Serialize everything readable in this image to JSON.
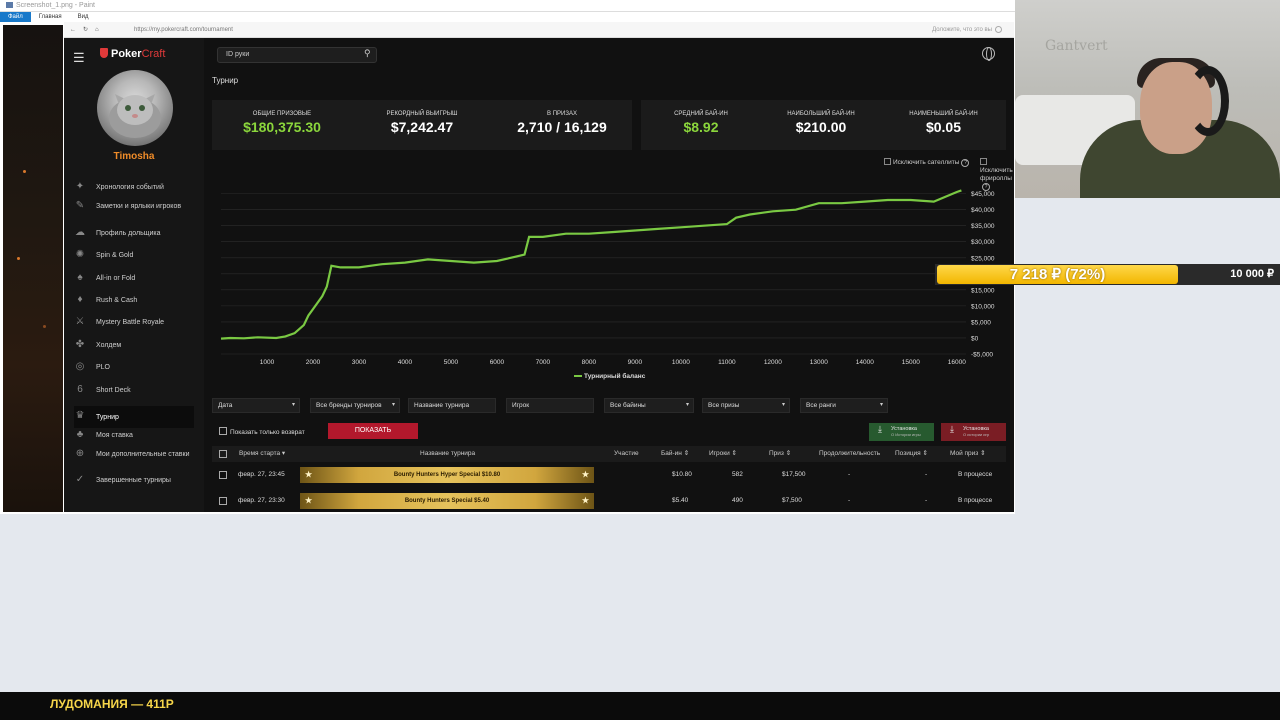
{
  "paint": {
    "title": "Screenshot_1.png - Paint",
    "menu": [
      "Файл",
      "Главная",
      "Вид"
    ]
  },
  "browser": {
    "url": "https://my.pokercraft.com/tournament",
    "hint": "Доложите, что это вы"
  },
  "sidebar": {
    "logo_left": "Poker",
    "logo_right": "Craft",
    "username": "Timosha",
    "items": [
      {
        "label": "Хронология событий",
        "icon": "timeline-icon"
      },
      {
        "label": "Заметки и ярлыки игроков",
        "icon": "notes-icon"
      },
      {
        "label": "Профиль дольщика",
        "icon": "cloud-icon"
      },
      {
        "label": "Spin & Gold",
        "icon": "spin-icon"
      },
      {
        "label": "All-in or Fold",
        "icon": "allin-icon"
      },
      {
        "label": "Rush & Cash",
        "icon": "rush-icon"
      },
      {
        "label": "Mystery Battle Royale",
        "icon": "battle-icon"
      },
      {
        "label": "Холдем",
        "icon": "holdem-icon"
      },
      {
        "label": "PLO",
        "icon": "plo-icon"
      },
      {
        "label": "Short Deck",
        "icon": "shortdeck-icon"
      },
      {
        "label": "Турнир",
        "icon": "trophy-icon"
      },
      {
        "label": "Моя ставка",
        "icon": "stake-icon"
      },
      {
        "label": "Мои дополнительные ставки",
        "icon": "extra-stake-icon"
      },
      {
        "label": "Завершенные турниры",
        "icon": "finished-icon"
      }
    ],
    "active_index": 10
  },
  "main": {
    "search_placeholder": "ID руки",
    "page_title": "Турнир",
    "stats_left": [
      {
        "label": "ОБЩИЕ ПРИЗОВЫЕ",
        "value": "$180,375.30",
        "green": true
      },
      {
        "label": "РЕКОРДНЫЙ ВЫИГРЫШ",
        "value": "$7,242.47",
        "green": false
      },
      {
        "label": "В ПРИЗАХ",
        "value": "2,710 / 16,129",
        "green": false
      }
    ],
    "stats_right": [
      {
        "label": "СРЕДНИЙ БАЙ-ИН",
        "value": "$8.92",
        "green": true
      },
      {
        "label": "НАИБОЛЬШИЙ БАЙ-ИН",
        "value": "$210.00",
        "green": false
      },
      {
        "label": "НАИМЕНЬШИЙ БАЙ-ИН",
        "value": "$0.05",
        "green": false
      }
    ],
    "exclude_satellites": "Исключить сателлиты",
    "exclude_freerolls": "Исключить фрироллы",
    "filters": [
      "Дата",
      "Все бренды турниров",
      "Название турнира",
      "Игрок",
      "Все байины",
      "Все призы",
      "Все ранги"
    ],
    "only_return": "Показать только возврат",
    "show_button": "ПОКАЗАТЬ",
    "download1": {
      "label": "Установка",
      "sub": "О Истории игры"
    },
    "download2": {
      "label": "Установка",
      "sub": "О истории игр"
    },
    "table": {
      "headers": [
        "Время старта",
        "Название турнира",
        "Участие",
        "Бай-ин",
        "Игроки",
        "Приз",
        "Продолжительность",
        "Позиция",
        "Мой приз"
      ],
      "rows": [
        {
          "time": "февр. 27, 23:45",
          "name": "Bounty Hunters Hyper Special $10.80",
          "buyin": "$10.80",
          "players": "582",
          "prize": "$17,500",
          "duration": "-",
          "position": "-",
          "my_prize": "В процессе"
        },
        {
          "time": "февр. 27, 23:30",
          "name": "Bounty Hunters Special $5.40",
          "buyin": "$5.40",
          "players": "490",
          "prize": "$7,500",
          "duration": "-",
          "position": "-",
          "my_prize": "В процессе"
        }
      ]
    }
  },
  "webcam": {
    "wall_text": "Gantvert"
  },
  "goal": {
    "current": "7 218 ₽ (72%)",
    "total": "10 000 ₽",
    "fraction": 0.72,
    "color": "#f2b600"
  },
  "banner": {
    "text": "ЛУДОМАНИЯ — 411Р"
  },
  "chart_data": {
    "type": "line",
    "series": [
      {
        "name": "Турнирный баланс",
        "color": "#7ac943",
        "x": [
          0,
          200,
          500,
          800,
          1200,
          1400,
          1600,
          1800,
          1900,
          2000,
          2200,
          2300,
          2400,
          2600,
          3000,
          3500,
          4000,
          4500,
          5000,
          5500,
          6000,
          6300,
          6600,
          6700,
          7000,
          7500,
          8000,
          8500,
          9000,
          9500,
          10000,
          10500,
          11000,
          11200,
          11500,
          12000,
          12500,
          13000,
          13500,
          14000,
          14500,
          15000,
          15500,
          16000,
          16100
        ],
        "y": [
          -200,
          0,
          -100,
          200,
          0,
          500,
          1500,
          4000,
          7000,
          9000,
          13000,
          16000,
          22500,
          22000,
          22000,
          23000,
          23500,
          24500,
          24000,
          23500,
          24000,
          25000,
          26000,
          31500,
          31500,
          32500,
          32500,
          33000,
          33500,
          34000,
          34500,
          35000,
          35500,
          37500,
          38500,
          39500,
          40000,
          42000,
          42000,
          42500,
          43000,
          43000,
          42500,
          45500,
          46000
        ]
      }
    ],
    "xticks": [
      1000,
      2000,
      3000,
      4000,
      5000,
      6000,
      7000,
      8000,
      9000,
      10000,
      11000,
      12000,
      13000,
      14000,
      15000,
      16000
    ],
    "yticks": [
      "-$5,000",
      "$0",
      "$5,000",
      "$10,000",
      "$15,000",
      "$20,000",
      "$25,000",
      "$30,000",
      "$35,000",
      "$40,000",
      "$45,000"
    ],
    "ytick_values": [
      -5000,
      0,
      5000,
      10000,
      15000,
      20000,
      25000,
      30000,
      35000,
      40000,
      45000
    ],
    "xlim": [
      0,
      16200
    ],
    "ylim": [
      -5000,
      48000
    ],
    "grid": true,
    "legend": "bottom"
  }
}
